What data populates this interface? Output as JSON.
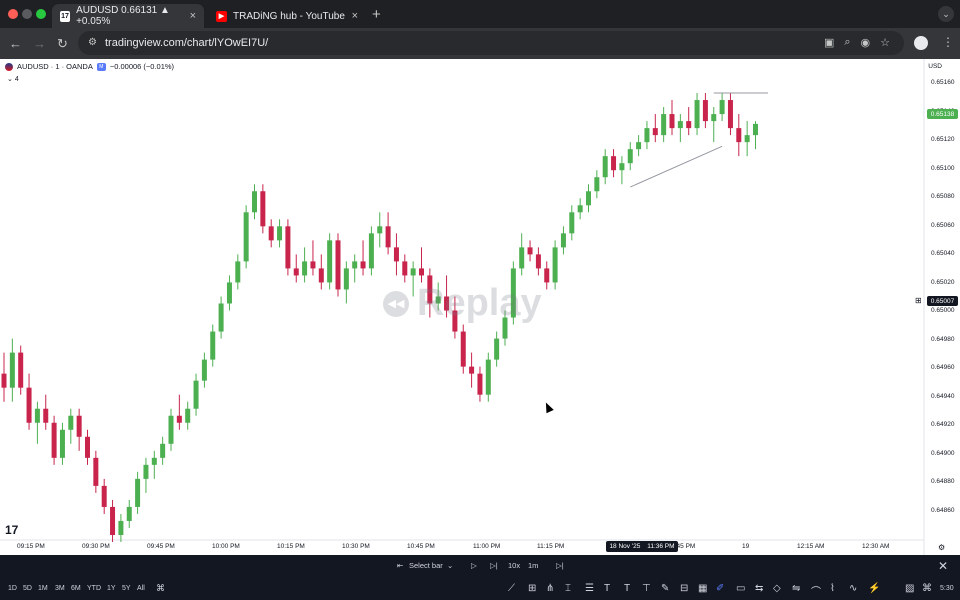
{
  "browser": {
    "tabs": [
      {
        "title": "AUDUSD 0.66131 ▲ +0.05%",
        "favicon": "tradingview-icon",
        "active": true
      },
      {
        "title": "TRADiNG hub - YouTube",
        "favicon": "youtube-icon",
        "active": false
      }
    ],
    "url": "tradingview.com/chart/lYOwEI7U/"
  },
  "chart": {
    "symbol": "AUDUSD · 1 · OANDA",
    "change": "−0.00006 (−0.01%)",
    "indicator_count": "4",
    "currency": "USD",
    "price_ticks": [
      "0.65160",
      "0.65140",
      "0.65120",
      "0.65100",
      "0.65080",
      "0.65060",
      "0.65040",
      "0.65020",
      "0.65000",
      "0.64980",
      "0.64960",
      "0.64940",
      "0.64920",
      "0.64900",
      "0.64880",
      "0.64860"
    ],
    "current_price_label": "0.65138",
    "crosshair_price_label": "0.65007",
    "time_ticks": [
      "09:15 PM",
      "09:30 PM",
      "09:45 PM",
      "10:00 PM",
      "10:15 PM",
      "10:30 PM",
      "10:45 PM",
      "11:00 PM",
      "11:15 PM",
      "11:45 PM",
      "19",
      "12:15 AM",
      "12:30 AM"
    ],
    "crosshair_date": "18 Nov '25",
    "crosshair_time": "11:36 PM",
    "watermark": "Replay",
    "colors": {
      "up": "#4caf50",
      "down": "#c8244c",
      "current_price": "#4caf50"
    }
  },
  "replay_bar": {
    "select_bar": "Select bar",
    "speed": "10x",
    "interval": "1m"
  },
  "bottom_toolbar": {
    "intervals": [
      "1D",
      "5D",
      "1M",
      "3M",
      "6M",
      "YTD",
      "1Y",
      "5Y",
      "All"
    ],
    "clock": "5:30"
  },
  "chart_data": {
    "type": "candlestick",
    "ylim": [
      0.64845,
      0.6517
    ],
    "candles": [
      [
        0.6496,
        0.64975,
        0.6494,
        0.6495
      ],
      [
        0.6495,
        0.64985,
        0.6494,
        0.64975
      ],
      [
        0.64975,
        0.6498,
        0.64945,
        0.6495
      ],
      [
        0.6495,
        0.6496,
        0.6492,
        0.64925
      ],
      [
        0.64925,
        0.6494,
        0.6491,
        0.64935
      ],
      [
        0.64935,
        0.64945,
        0.6492,
        0.64925
      ],
      [
        0.64925,
        0.6493,
        0.64895,
        0.649
      ],
      [
        0.649,
        0.64925,
        0.64895,
        0.6492
      ],
      [
        0.6492,
        0.64935,
        0.6491,
        0.6493
      ],
      [
        0.6493,
        0.64935,
        0.64905,
        0.64915
      ],
      [
        0.64915,
        0.6492,
        0.64895,
        0.649
      ],
      [
        0.649,
        0.64905,
        0.64875,
        0.6488
      ],
      [
        0.6488,
        0.64885,
        0.6486,
        0.64865
      ],
      [
        0.64865,
        0.6487,
        0.6484,
        0.64845
      ],
      [
        0.64845,
        0.6486,
        0.6484,
        0.64855
      ],
      [
        0.64855,
        0.6487,
        0.6485,
        0.64865
      ],
      [
        0.64865,
        0.6489,
        0.6486,
        0.64885
      ],
      [
        0.64885,
        0.649,
        0.64875,
        0.64895
      ],
      [
        0.64895,
        0.64905,
        0.64885,
        0.649
      ],
      [
        0.649,
        0.64915,
        0.64895,
        0.6491
      ],
      [
        0.6491,
        0.64935,
        0.64905,
        0.6493
      ],
      [
        0.6493,
        0.64945,
        0.6492,
        0.64925
      ],
      [
        0.64925,
        0.6494,
        0.6492,
        0.64935
      ],
      [
        0.64935,
        0.6496,
        0.6493,
        0.64955
      ],
      [
        0.64955,
        0.64975,
        0.6495,
        0.6497
      ],
      [
        0.6497,
        0.64995,
        0.64965,
        0.6499
      ],
      [
        0.6499,
        0.65015,
        0.64985,
        0.6501
      ],
      [
        0.6501,
        0.6503,
        0.65005,
        0.65025
      ],
      [
        0.65025,
        0.65045,
        0.6502,
        0.6504
      ],
      [
        0.6504,
        0.6508,
        0.65035,
        0.65075
      ],
      [
        0.65075,
        0.65095,
        0.6507,
        0.6509
      ],
      [
        0.6509,
        0.65095,
        0.6506,
        0.65065
      ],
      [
        0.65065,
        0.6507,
        0.6505,
        0.65055
      ],
      [
        0.65055,
        0.6507,
        0.6505,
        0.65065
      ],
      [
        0.65065,
        0.6507,
        0.6503,
        0.65035
      ],
      [
        0.65035,
        0.65045,
        0.65025,
        0.6503
      ],
      [
        0.6503,
        0.6505,
        0.65025,
        0.6504
      ],
      [
        0.6504,
        0.65055,
        0.6503,
        0.65035
      ],
      [
        0.65035,
        0.65045,
        0.6502,
        0.65025
      ],
      [
        0.65025,
        0.6506,
        0.6502,
        0.65055
      ],
      [
        0.65055,
        0.6506,
        0.65015,
        0.6502
      ],
      [
        0.6502,
        0.6504,
        0.6501,
        0.65035
      ],
      [
        0.65035,
        0.65045,
        0.65025,
        0.6504
      ],
      [
        0.6504,
        0.65055,
        0.6503,
        0.65035
      ],
      [
        0.65035,
        0.65065,
        0.6503,
        0.6506
      ],
      [
        0.6506,
        0.65075,
        0.6505,
        0.65065
      ],
      [
        0.65065,
        0.65075,
        0.65045,
        0.6505
      ],
      [
        0.6505,
        0.6506,
        0.6503,
        0.6504
      ],
      [
        0.6504,
        0.65045,
        0.65025,
        0.6503
      ],
      [
        0.6503,
        0.6504,
        0.65015,
        0.65035
      ],
      [
        0.65035,
        0.6505,
        0.65025,
        0.6503
      ],
      [
        0.6503,
        0.65035,
        0.65,
        0.6501
      ],
      [
        0.6501,
        0.65025,
        0.65005,
        0.65015
      ],
      [
        0.65015,
        0.6503,
        0.65,
        0.65005
      ],
      [
        0.65005,
        0.65015,
        0.64985,
        0.6499
      ],
      [
        0.6499,
        0.64995,
        0.6496,
        0.64965
      ],
      [
        0.64965,
        0.64975,
        0.6495,
        0.6496
      ],
      [
        0.6496,
        0.64965,
        0.6494,
        0.64945
      ],
      [
        0.64945,
        0.64975,
        0.6494,
        0.6497
      ],
      [
        0.6497,
        0.6499,
        0.64965,
        0.64985
      ],
      [
        0.64985,
        0.65005,
        0.6498,
        0.65
      ],
      [
        0.65,
        0.6504,
        0.64995,
        0.65035
      ],
      [
        0.65035,
        0.6506,
        0.6503,
        0.6505
      ],
      [
        0.6505,
        0.65055,
        0.6504,
        0.65045
      ],
      [
        0.65045,
        0.6505,
        0.6503,
        0.65035
      ],
      [
        0.65035,
        0.6504,
        0.6502,
        0.65025
      ],
      [
        0.65025,
        0.65055,
        0.6502,
        0.6505
      ],
      [
        0.6505,
        0.65065,
        0.65045,
        0.6506
      ],
      [
        0.6506,
        0.6508,
        0.65055,
        0.65075
      ],
      [
        0.65075,
        0.65085,
        0.6507,
        0.6508
      ],
      [
        0.6508,
        0.65095,
        0.65075,
        0.6509
      ],
      [
        0.6509,
        0.65105,
        0.65085,
        0.651
      ],
      [
        0.651,
        0.6512,
        0.65095,
        0.65115
      ],
      [
        0.65115,
        0.6512,
        0.651,
        0.65105
      ],
      [
        0.65105,
        0.65115,
        0.65095,
        0.6511
      ],
      [
        0.6511,
        0.65125,
        0.65105,
        0.6512
      ],
      [
        0.6512,
        0.6513,
        0.65115,
        0.65125
      ],
      [
        0.65125,
        0.6514,
        0.6512,
        0.65135
      ],
      [
        0.65135,
        0.65145,
        0.65125,
        0.6513
      ],
      [
        0.6513,
        0.6515,
        0.65125,
        0.65145
      ],
      [
        0.65145,
        0.65155,
        0.6513,
        0.65135
      ],
      [
        0.65135,
        0.65145,
        0.65125,
        0.6514
      ],
      [
        0.6514,
        0.6515,
        0.6513,
        0.65135
      ],
      [
        0.65135,
        0.6516,
        0.6513,
        0.65155
      ],
      [
        0.65155,
        0.6516,
        0.65135,
        0.6514
      ],
      [
        0.6514,
        0.6515,
        0.65125,
        0.65145
      ],
      [
        0.65145,
        0.6516,
        0.6514,
        0.65155
      ],
      [
        0.65155,
        0.6516,
        0.6513,
        0.65135
      ],
      [
        0.65135,
        0.65145,
        0.65115,
        0.65125
      ],
      [
        0.65125,
        0.6514,
        0.65115,
        0.6513
      ],
      [
        0.6513,
        0.6514,
        0.6512,
        0.65138
      ]
    ],
    "trendline": {
      "from": [
        0.65093,
        75
      ],
      "to": [
        0.65122,
        86
      ]
    },
    "hline": 0.6516
  }
}
